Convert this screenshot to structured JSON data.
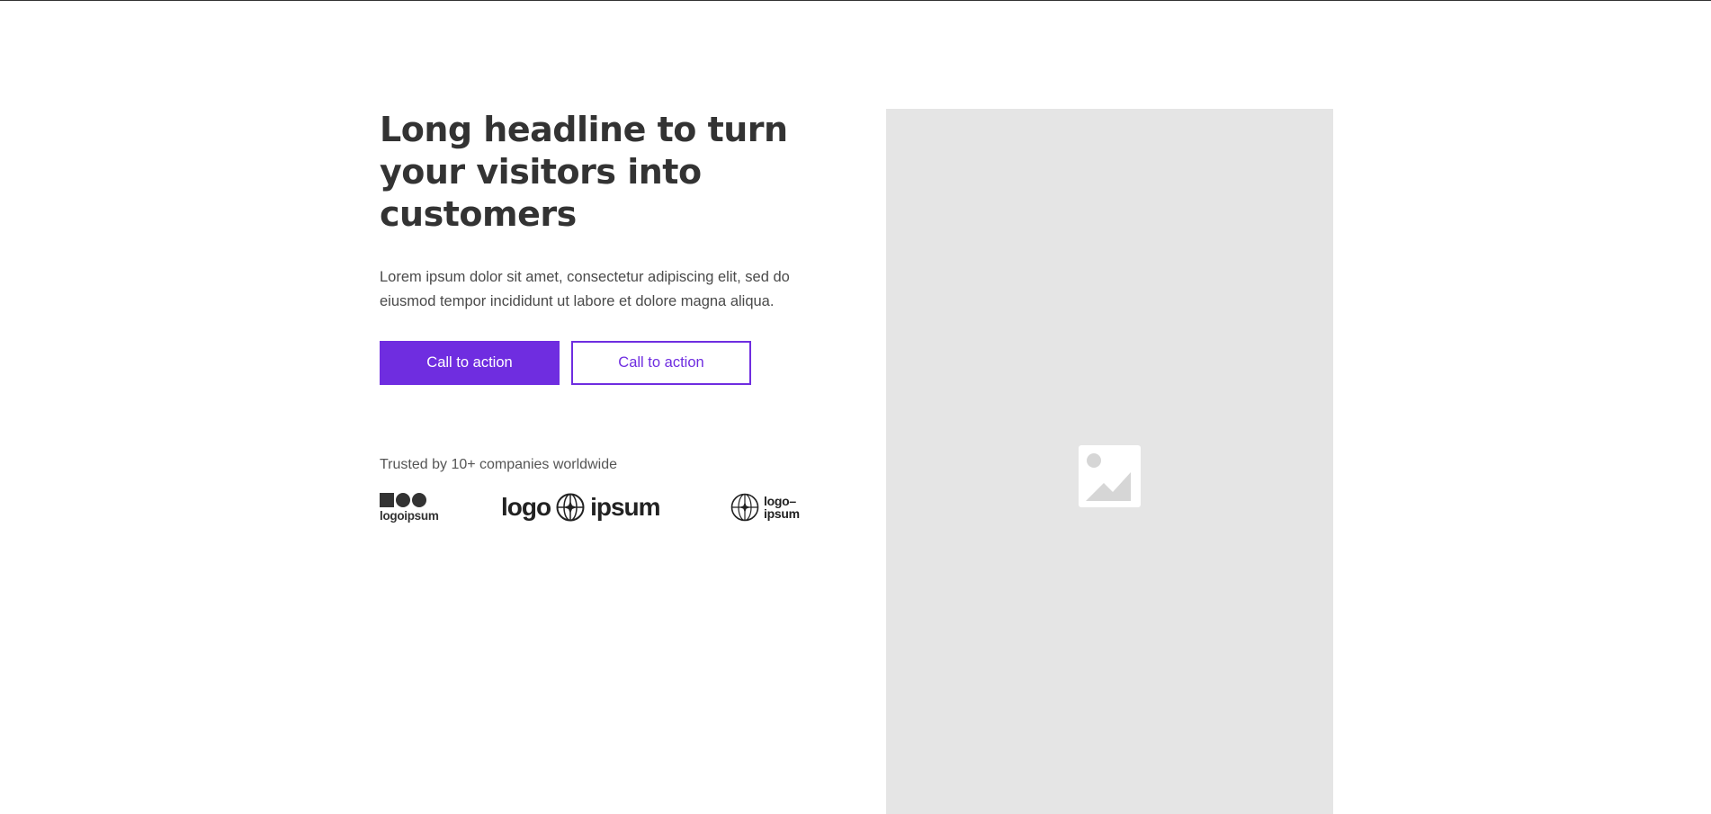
{
  "hero": {
    "headline": "Long headline to turn your visitors into customers",
    "lede": "Lorem ipsum dolor sit amet, consectetur adipiscing elit, sed do eiusmod tempor incididunt ut labore et dolore magna aliqua.",
    "primary_cta": "Call to action",
    "secondary_cta": "Call to action",
    "trusted_text": "Trusted by 10+ companies worldwide"
  },
  "logos": [
    {
      "name": "logoipsum",
      "text": "logoipsum"
    },
    {
      "name": "logo ipsum",
      "left": "logo",
      "right": "ipsum"
    },
    {
      "name": "logo-ipsum",
      "line1": "logo–",
      "line2": "ipsum"
    }
  ],
  "media": {
    "icon": "image-placeholder-icon"
  },
  "colors": {
    "accent": "#6f2de0",
    "text": "#333333",
    "placeholder": "#e5e5e5"
  }
}
